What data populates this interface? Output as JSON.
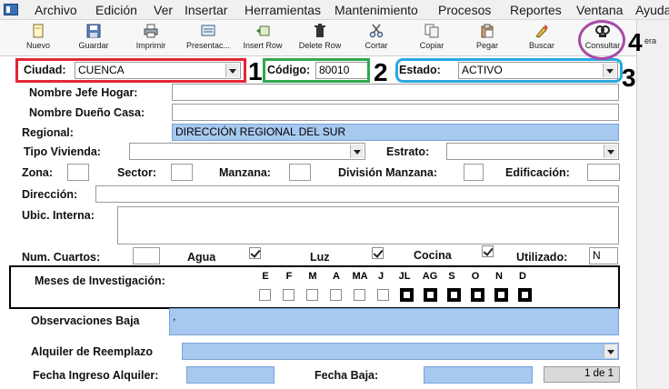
{
  "menu": [
    "Archivo",
    "Edición",
    "Ver",
    "Insertar",
    "Herramientas",
    "Mantenimiento",
    "Procesos",
    "Reportes",
    "Ventana",
    "Ayuda"
  ],
  "toolbar": [
    {
      "label": "Nuevo",
      "icon": "new-document-icon"
    },
    {
      "label": "Guardar",
      "icon": "save-icon"
    },
    {
      "label": "Imprimir",
      "icon": "print-icon"
    },
    {
      "label": "Presentac...",
      "icon": "presentation-icon"
    },
    {
      "label": "Insert Row",
      "icon": "insert-row-icon"
    },
    {
      "label": "Delete Row",
      "icon": "delete-row-icon"
    },
    {
      "label": "Cortar",
      "icon": "cut-icon"
    },
    {
      "label": "Copiar",
      "icon": "copy-icon"
    },
    {
      "label": "Pegar",
      "icon": "paste-icon"
    },
    {
      "label": "Buscar",
      "icon": "search-icon"
    },
    {
      "label": "Consultar",
      "icon": "query-icon"
    }
  ],
  "toolbar_cut_label": "era",
  "form": {
    "ciudad_label": "Ciudad:",
    "ciudad_value": "CUENCA",
    "codigo_label": "Código:",
    "codigo_value": "80010",
    "estado_label": "Estado:",
    "estado_value": "ACTIVO",
    "jefe_label": "Nombre Jefe Hogar:",
    "jefe_value": "",
    "dueno_label": "Nombre Dueño Casa:",
    "dueno_value": "",
    "regional_label": "Regional:",
    "regional_value": "DIRECCIÓN REGIONAL DEL SUR",
    "tipo_label": "Tipo Vivienda:",
    "tipo_value": "",
    "estrato_label": "Estrato:",
    "estrato_value": "",
    "zona_label": "Zona:",
    "sector_label": "Sector:",
    "manzana_label": "Manzana:",
    "division_label": "División Manzana:",
    "edificacion_label": "Edificación:",
    "direccion_label": "Dirección:",
    "ubic_label": "Ubic. Interna:",
    "cuartos_label": "Num. Cuartos:",
    "agua_label": "Agua",
    "luz_label": "Luz",
    "cocina_label": "Cocina",
    "utilizado_label": "Utilizado:",
    "utilizado_value": "N",
    "meses_label": "Meses de Investigación:",
    "meses": [
      "E",
      "F",
      "M",
      "A",
      "MA",
      "J",
      "JL",
      "AG",
      "S",
      "O",
      "N",
      "D"
    ],
    "observaciones_label": "Observaciones Baja",
    "observaciones_value": ",",
    "alquiler_label": "Alquiler de Reemplazo",
    "fecha_ingreso_label": "Fecha Ingreso Alquiler:",
    "fecha_baja_label": "Fecha Baja:",
    "pager": "1 de 1"
  },
  "checks": {
    "agua": true,
    "luz": true,
    "cocina": true
  },
  "annotations": [
    "1",
    "2",
    "3",
    "4"
  ],
  "colors": {
    "red": "#e32636",
    "green": "#2fa84f",
    "blue": "#29a8e0",
    "purple": "#a64ca6",
    "field_blue": "#a7c8ef"
  }
}
